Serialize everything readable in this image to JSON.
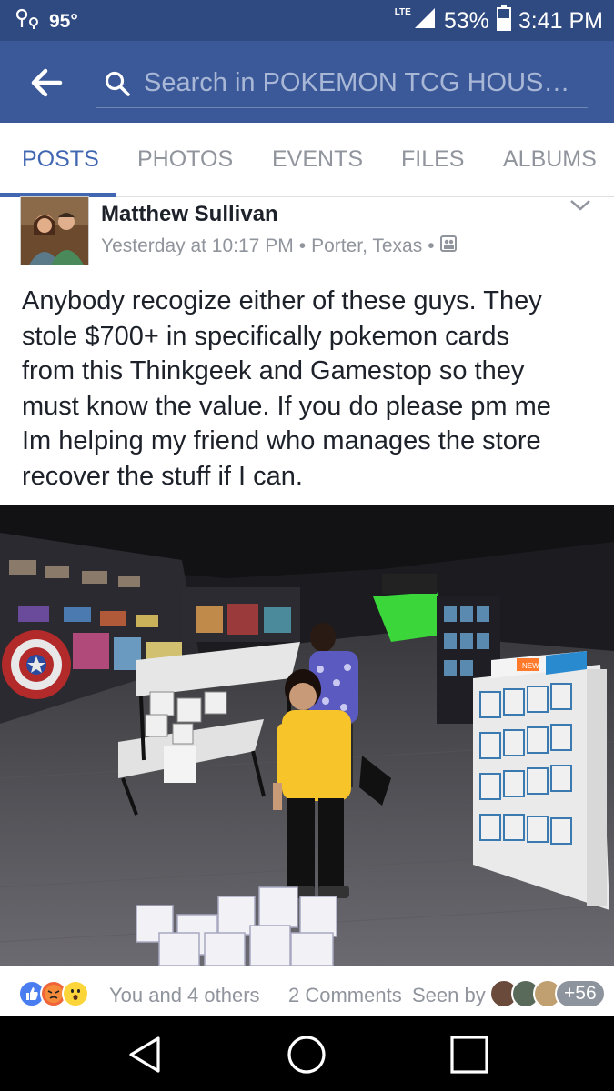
{
  "status_bar": {
    "temperature": "95°",
    "network": "LTE",
    "battery": "53%",
    "time": "3:41 PM"
  },
  "app_bar": {
    "search_placeholder": "Search in POKEMON TCG HOUST…"
  },
  "tabs": [
    {
      "label": "POSTS",
      "active": true
    },
    {
      "label": "PHOTOS",
      "active": false
    },
    {
      "label": "EVENTS",
      "active": false
    },
    {
      "label": "FILES",
      "active": false
    },
    {
      "label": "ALBUMS",
      "active": false
    }
  ],
  "post": {
    "author": "Matthew Sullivan",
    "time": "Yesterday at 10:17 PM",
    "location": "Porter, Texas",
    "separator": "•",
    "audience_icon": "group-audience-icon",
    "text_lines": [
      "Anybody recogize either of these guys.  They",
      "stole $700+ in specifically pokemon cards",
      "from this Thinkgeek and Gamestop so they",
      "must know the value.  If you do please pm me",
      "Im helping my friend who manages the store",
      "recover the stuff if I can."
    ]
  },
  "photo": {
    "sign_text": "NEW"
  },
  "reactions": {
    "icons": [
      "like-icon",
      "angry-icon",
      "wow-icon"
    ],
    "summary": "You and 4 others",
    "comments": "2 Comments",
    "seen_by": "Seen by",
    "seen_count": "+56"
  },
  "colors": {
    "brand": "#3b5998",
    "status_bar": "#2f4a80",
    "tab_active": "#4267b2",
    "secondary_text": "#90949c"
  }
}
